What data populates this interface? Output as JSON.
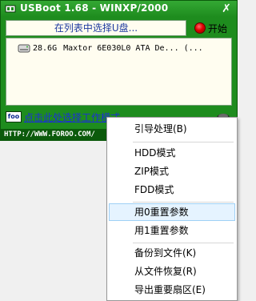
{
  "window": {
    "title": "USBoot 1.68 - WINXP/2000",
    "close_glyph": "✗"
  },
  "prompt": "在列表中选择U盘...",
  "start_button": {
    "label": "开始",
    "icon": "red-circle-icon"
  },
  "disks": [
    {
      "size": "28.6G",
      "description": "Maxtor 6E030L0 ATA De... (..."
    }
  ],
  "footer": {
    "select_mode_link": "点击此处选择工作模式",
    "website": "HTTP://WWW.FOROO.COM/",
    "logo_text": "foo"
  },
  "context_menu": {
    "items": [
      {
        "label": "引导处理(B)"
      },
      {
        "label": "HDD模式"
      },
      {
        "label": "ZIP模式"
      },
      {
        "label": "FDD模式"
      },
      {
        "label": "用0重置参数",
        "highlighted": true
      },
      {
        "label": "用1重置参数"
      },
      {
        "label": "备份到文件(K)"
      },
      {
        "label": "从文件恢复(R)"
      },
      {
        "label": "导出重要扇区(E)"
      }
    ]
  },
  "colors": {
    "window_green": "#1e8c1e",
    "status_dark_green": "#0b5a0b",
    "link_blue": "#1c2fd6",
    "menu_highlight": "#e5f3ff"
  }
}
